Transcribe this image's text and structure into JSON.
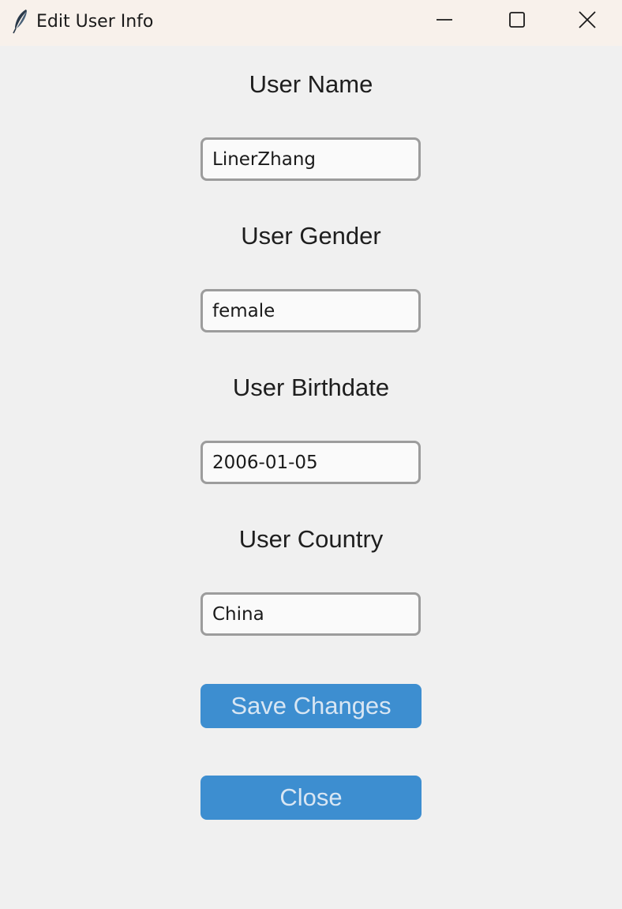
{
  "window": {
    "title": "Edit User Info",
    "icon": "feather-icon",
    "controls": [
      "minimize-icon",
      "maximize-icon",
      "close-icon"
    ]
  },
  "form": {
    "name": {
      "label": "User Name",
      "value": "LinerZhang"
    },
    "gender": {
      "label": "User Gender",
      "value": "female"
    },
    "birthdate": {
      "label": "User Birthdate",
      "value": "2006-01-05"
    },
    "country": {
      "label": "User Country",
      "value": "China"
    }
  },
  "buttons": {
    "save_label": "Save Changes",
    "close_label": "Close"
  },
  "colors": {
    "titlebar": "#f8f1eb",
    "background": "#f0f0f0",
    "button": "#3d8ed0",
    "button_text": "#d8e6f3",
    "input_border": "#9c9c9c"
  }
}
